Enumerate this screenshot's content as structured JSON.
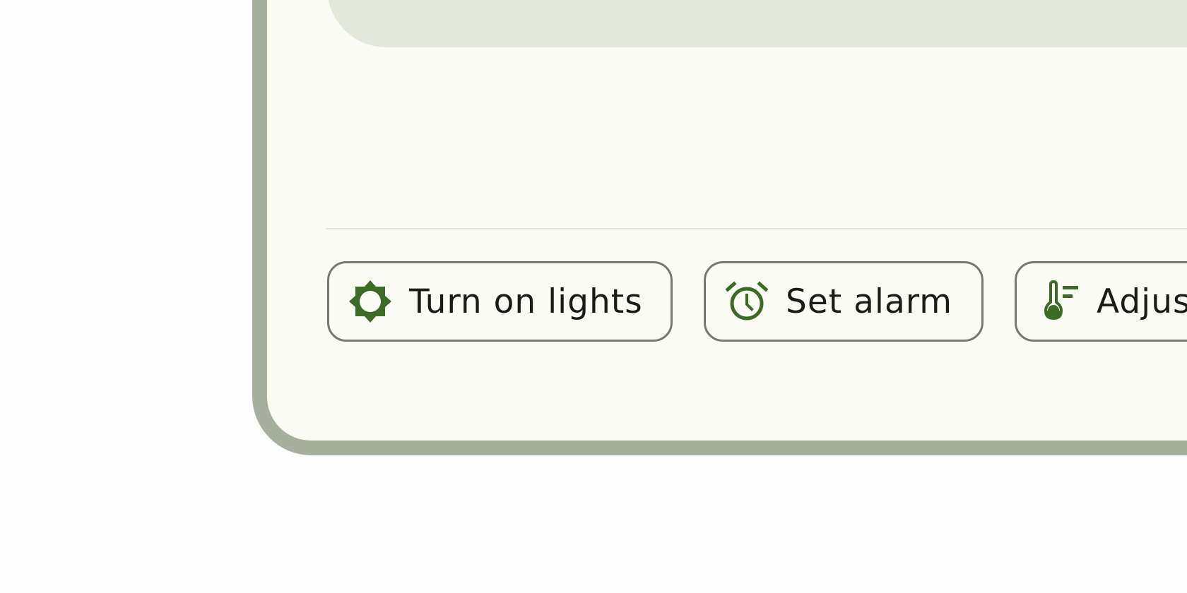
{
  "colors": {
    "device_frame": "#a7b09c",
    "screen_background": "#fbfbf5",
    "top_card": "#e2e8da",
    "chip_border": "#767970",
    "chip_text": "#1b1c18",
    "icon_accent": "#3c6b25"
  },
  "suggestions": [
    {
      "label": "Turn on lights",
      "icon": "brightness-icon"
    },
    {
      "label": "Set alarm",
      "icon": "alarm-clock-icon"
    },
    {
      "label": "Adjust",
      "icon": "thermostat-icon"
    }
  ]
}
